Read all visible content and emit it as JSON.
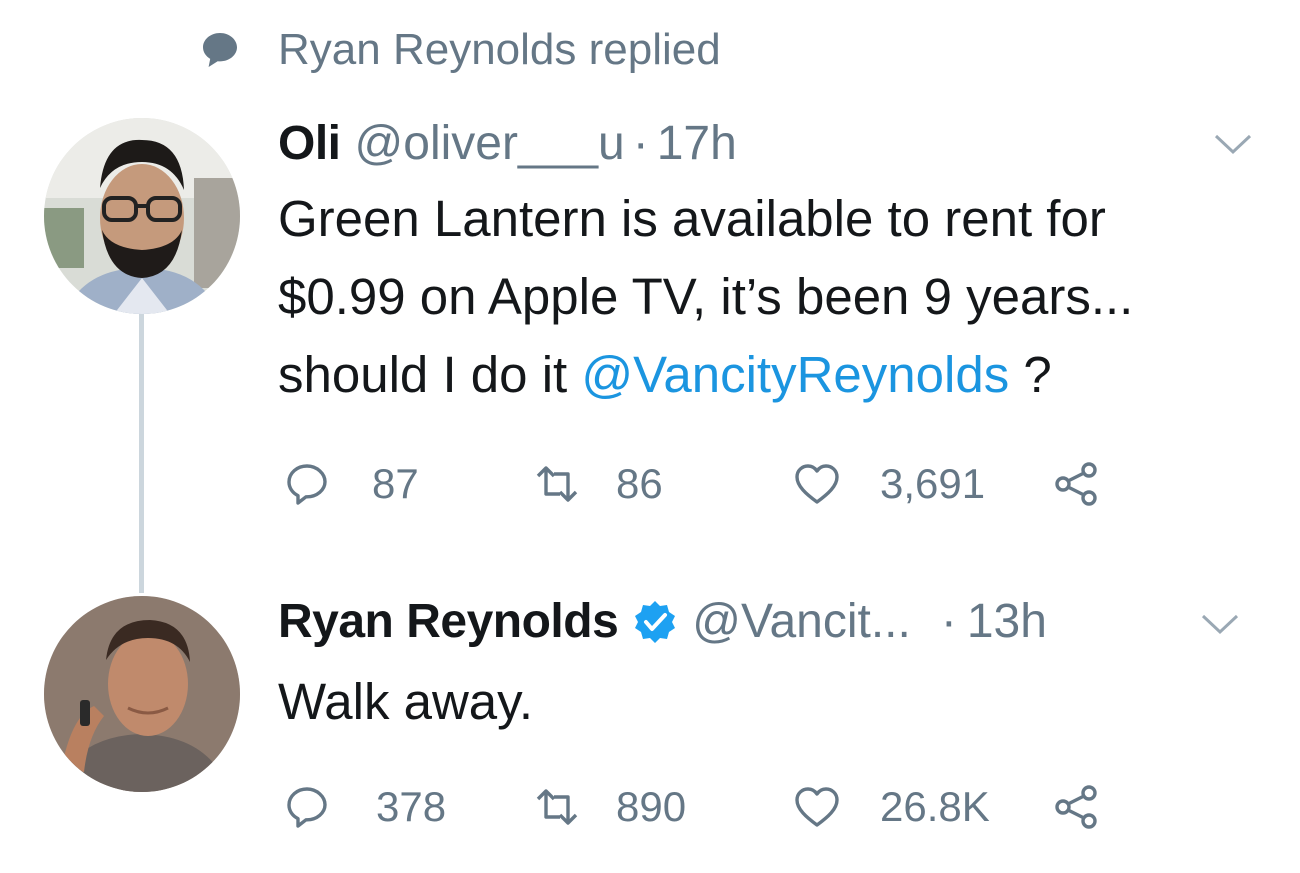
{
  "context": {
    "text": "Ryan Reynolds replied",
    "icon": "speech-bubble-icon"
  },
  "tweets": [
    {
      "name": "Oli",
      "handle": "@oliver___u",
      "separator": "·",
      "time": "17h",
      "verified": false,
      "body_lines": [
        "Green Lantern is available to rent for",
        "$0.99 on Apple TV, it’s been 9 years...",
        "should I do it "
      ],
      "mention": "@VancityReynolds",
      "body_tail": " ?",
      "replies": "87",
      "retweets": "86",
      "likes": "3,691"
    },
    {
      "name": "Ryan Reynolds",
      "handle": "@Vancit...",
      "separator": "·",
      "time": "13h",
      "verified": true,
      "body": "Walk away.",
      "replies": "378",
      "retweets": "890",
      "likes": "26.8K"
    }
  ],
  "colors": {
    "text": "#14171a",
    "muted": "#657786",
    "mention": "#1b95e0",
    "verified": "#1da1f2",
    "thread_line": "#ccd6dd"
  }
}
